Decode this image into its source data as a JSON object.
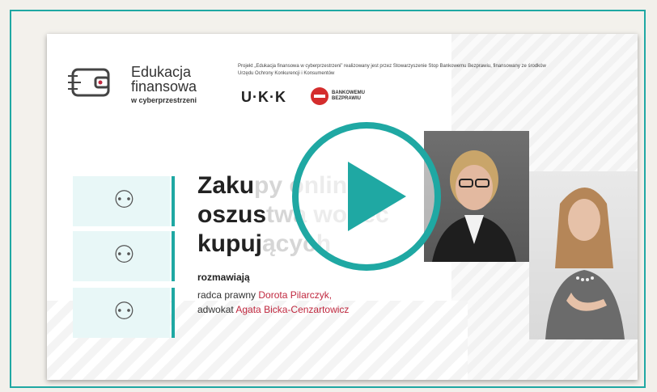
{
  "brand": {
    "line1": "Edukacja",
    "line2": "finansowa",
    "line3": "w cyberprzestrzeni"
  },
  "project_note": "Projekt „Edukacja finansowa w cyberprzestrzeni” realizowany jest przez Stowarzyszenie Stop Bankowemu Bezprawiu, finansowany ze środków Urzędu Ochrony Konkurencji i Konsumentów",
  "partners": {
    "uokik": "U·K·K",
    "bb_line1": "BANKOWEMU",
    "bb_line2": "BEZPRAWIU"
  },
  "video": {
    "title_line1_a": "Zaku",
    "title_line1_b": "py online,",
    "title_line2_a": "oszus",
    "title_line2_b": "twa wobec",
    "title_line3_a": "kupuj",
    "title_line3_b": "ących",
    "talk_label": "rozmawiają",
    "speaker1_role": "radca prawny ",
    "speaker1_name": "Dorota Pilarczyk,",
    "speaker2_role": "adwokat ",
    "speaker2_name": "Agata Bicka-Cenzartowicz"
  },
  "icons": [
    "people-group-icon",
    "people-group-icon",
    "people-group-icon",
    "play-icon",
    "wallet-logo-icon"
  ],
  "colors": {
    "accent": "#1fa8a3",
    "name": "#c0283f",
    "stop": "#d42d2d"
  }
}
